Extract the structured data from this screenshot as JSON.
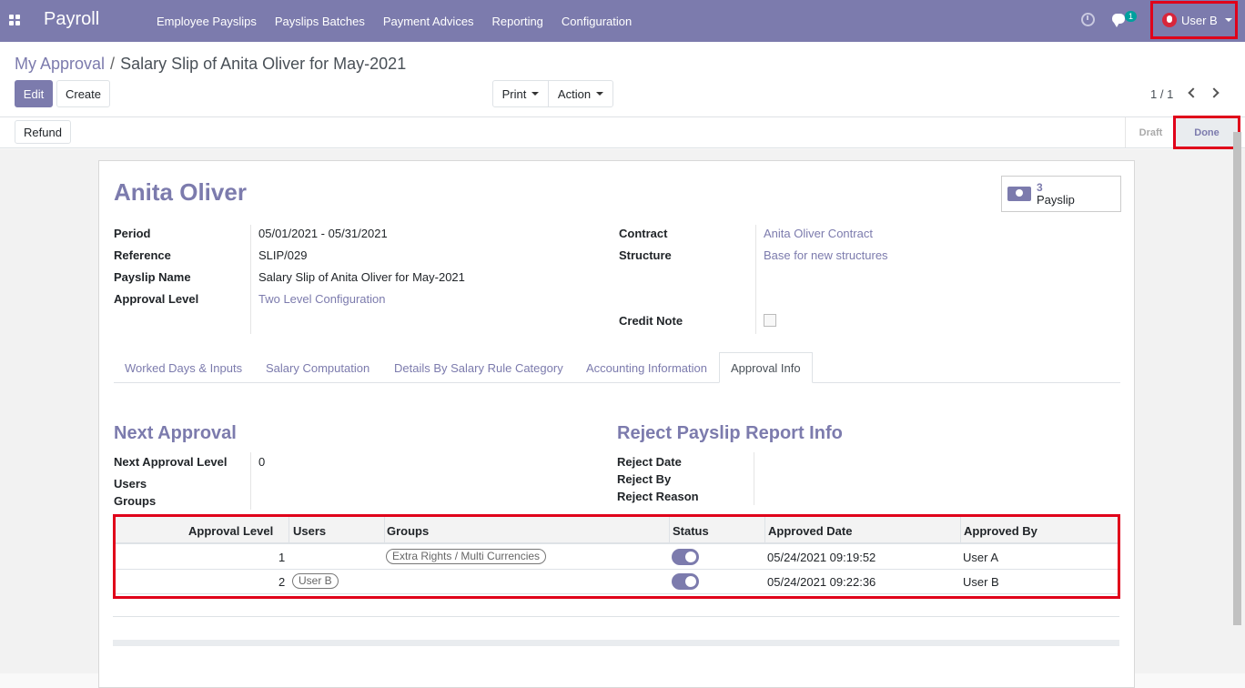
{
  "navbar": {
    "brand": "Payroll",
    "menu": [
      "Employee Payslips",
      "Payslips Batches",
      "Payment Advices",
      "Reporting",
      "Configuration"
    ],
    "chat_count": "1",
    "user": "User B"
  },
  "control": {
    "breadcrumb_parent": "My Approval",
    "breadcrumb_sep": "/",
    "breadcrumb_current": "Salary Slip of Anita Oliver for May-2021",
    "edit_label": "Edit",
    "create_label": "Create",
    "print_label": "Print",
    "action_label": "Action",
    "pager": "1 / 1"
  },
  "statusbar": {
    "refund_label": "Refund",
    "draft_label": "Draft",
    "done_label": "Done"
  },
  "form": {
    "employee": "Anita Oliver",
    "smart_count": "3",
    "smart_label": "Payslip",
    "left": [
      {
        "label": "Period",
        "value": "05/01/2021 - 05/31/2021"
      },
      {
        "label": "Reference",
        "value": "SLIP/029"
      },
      {
        "label": "Payslip Name",
        "value": "Salary Slip of Anita Oliver for May-2021"
      },
      {
        "label": "Approval Level",
        "value": "Two Level Configuration"
      }
    ],
    "right": [
      {
        "label": "Contract",
        "value": "Anita Oliver Contract"
      },
      {
        "label": "Structure",
        "value": "Base for new structures"
      },
      {
        "label": "Credit Note",
        "value": ""
      }
    ]
  },
  "tabs": [
    "Worked Days & Inputs",
    "Salary Computation",
    "Details By Salary Rule Category",
    "Accounting Information",
    "Approval Info"
  ],
  "approval": {
    "next_title": "Next Approval",
    "reject_title": "Reject Payslip Report Info",
    "next_level_label": "Next Approval Level",
    "next_level_value": "0",
    "users_label": "Users",
    "groups_label": "Groups",
    "reject_date_label": "Reject Date",
    "reject_by_label": "Reject By",
    "reject_reason_label": "Reject Reason"
  },
  "table": {
    "headers": [
      "Approval Level",
      "Users",
      "Groups",
      "Status",
      "Approved Date",
      "Approved By"
    ],
    "rows": [
      {
        "level": "1",
        "user": "",
        "group": "Extra Rights / Multi Currencies",
        "status": true,
        "date": "05/24/2021 09:19:52",
        "by": "User A"
      },
      {
        "level": "2",
        "user": "User B",
        "group": "",
        "status": true,
        "date": "05/24/2021 09:22:36",
        "by": "User B"
      }
    ]
  },
  "colors": {
    "brand": "#7c7bad",
    "highlight": "#e0001a"
  }
}
